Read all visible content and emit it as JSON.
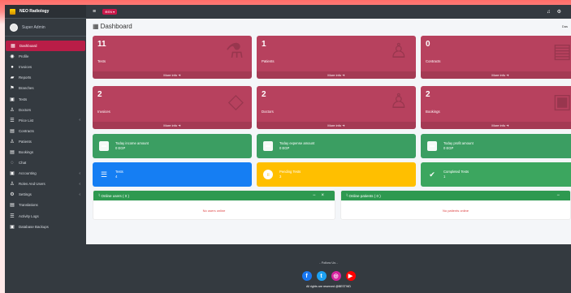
{
  "brand": {
    "title": "NEO Radiology"
  },
  "user": {
    "name": "Super Admin"
  },
  "topbar": {
    "language": "EN"
  },
  "page": {
    "title": "Dashboard",
    "breadcrumb": "Das"
  },
  "sidebar": {
    "items": [
      {
        "label": "Dashboard",
        "icon": "dashboard-icon"
      },
      {
        "label": "Profile",
        "icon": "profile-icon"
      },
      {
        "label": "Invoices",
        "icon": "invoices-icon"
      },
      {
        "label": "Reports",
        "icon": "reports-icon"
      },
      {
        "label": "Branches",
        "icon": "branches-icon"
      },
      {
        "label": "Tests",
        "icon": "tests-icon"
      },
      {
        "label": "Doctors",
        "icon": "doctors-icon"
      },
      {
        "label": "Price List",
        "icon": "price-list-icon"
      },
      {
        "label": "Contracts",
        "icon": "contracts-icon"
      },
      {
        "label": "Patients",
        "icon": "patients-icon"
      },
      {
        "label": "Bookings",
        "icon": "bookings-icon"
      },
      {
        "label": "Chat",
        "icon": "chat-icon"
      },
      {
        "label": "Accounting",
        "icon": "accounting-icon"
      },
      {
        "label": "Roles And Users",
        "icon": "roles-users-icon"
      },
      {
        "label": "Settings",
        "icon": "settings-icon"
      },
      {
        "label": "Translations",
        "icon": "translations-icon"
      },
      {
        "label": "Activity Logs",
        "icon": "activity-logs-icon"
      },
      {
        "label": "Database Backups",
        "icon": "database-backups-icon"
      }
    ]
  },
  "stats": {
    "tests": {
      "value": "11",
      "label": "Tests",
      "more": "More info"
    },
    "patients": {
      "value": "1",
      "label": "Patients",
      "more": "More info"
    },
    "contracts": {
      "value": "0",
      "label": "Contracts",
      "more": "More info"
    },
    "invoices": {
      "value": "2",
      "label": "Invoices",
      "more": "More info"
    },
    "doctors": {
      "value": "2",
      "label": "Doctors",
      "more": "More info"
    },
    "bookings": {
      "value": "2",
      "label": "Bookings",
      "more": "More info"
    }
  },
  "income": {
    "today_income": {
      "label": "Today income amount",
      "value": "0 EGP"
    },
    "today_expense": {
      "label": "Today expense amount",
      "value": "0 EGP"
    },
    "today_profit": {
      "label": "Today profit amount",
      "value": "0 EGP"
    }
  },
  "test_status": {
    "tests": {
      "label": "Tests",
      "value": "4"
    },
    "pending": {
      "label": "Pending Tests",
      "value": "3"
    },
    "completed": {
      "label": "Completed Tests",
      "value": "1"
    }
  },
  "online_users": {
    "title": "Online users ( 0 )",
    "empty": "No users online"
  },
  "online_patients": {
    "title": "Online patients ( 0 )",
    "empty": "No patients online"
  },
  "footer": {
    "follow": "- Follow Us -",
    "rights": "All rights are reserved @BESTWD"
  },
  "colors": {
    "sidebar": "#343a40",
    "active": "#b91d47",
    "maroon_box": "#b7415e",
    "green": "#3b9e62",
    "blue": "#157ef3",
    "yellow": "#ffbf00",
    "card_header": "#2e9950"
  }
}
